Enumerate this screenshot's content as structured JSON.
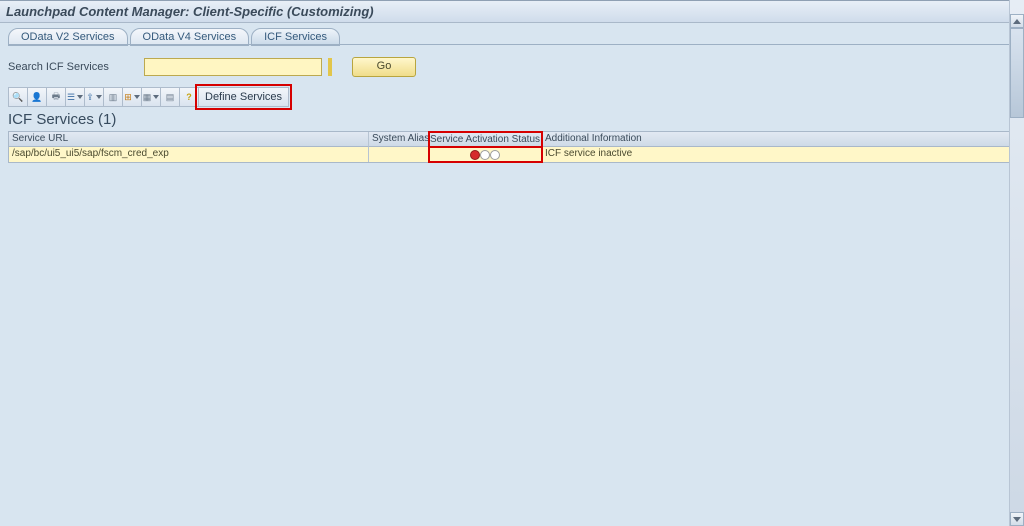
{
  "header": {
    "title": "Launchpad Content Manager: Client-Specific (Customizing)"
  },
  "tabs": [
    {
      "label": "OData V2 Services",
      "active": false
    },
    {
      "label": "OData V4 Services",
      "active": false
    },
    {
      "label": "ICF Services",
      "active": true
    }
  ],
  "search": {
    "label": "Search ICF Services",
    "value": "",
    "go_label": "Go"
  },
  "toolbar": {
    "define_services_label": "Define Services",
    "icons": [
      "detail-icon",
      "user-icon",
      "print-icon",
      "filter-icon",
      "export-icon",
      "column-icon",
      "excel-icon",
      "layout-icon",
      "grid-icon",
      "help-icon"
    ]
  },
  "section": {
    "title": "ICF Services (1)"
  },
  "table": {
    "columns": {
      "url": "Service URL",
      "alias": "System Alias",
      "status": "Service Activation Status",
      "info": "Additional Information"
    },
    "rows": [
      {
        "url": "/sap/bc/ui5_ui5/sap/fscm_cred_exp",
        "alias": "",
        "status_state": "inactive",
        "info": "ICF service inactive"
      }
    ]
  }
}
